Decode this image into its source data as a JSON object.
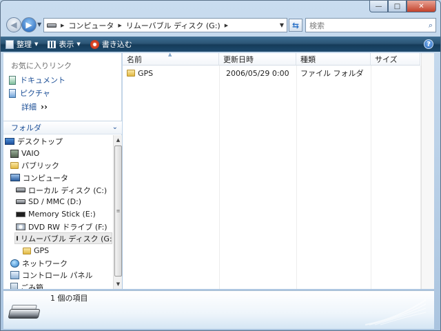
{
  "window": {
    "controls": {
      "minimize": "—",
      "maximize": "□",
      "close": "✕"
    }
  },
  "address_bar": {
    "crumbs": [
      "コンピュータ",
      "リムーバブル ディスク (G:)"
    ],
    "search_placeholder": "検索"
  },
  "toolbar": {
    "organize": "整理",
    "views": "表示",
    "burn": "書き込む",
    "help": "?"
  },
  "favorites": {
    "title": "お気に入りリンク",
    "items": [
      "ドキュメント",
      "ピクチャ"
    ],
    "more": "詳細"
  },
  "folders": {
    "header": "フォルダ",
    "tree": [
      {
        "label": "デスクトップ",
        "icon": "desktop-icon"
      },
      {
        "label": "VAIO",
        "icon": "user-folder-icon"
      },
      {
        "label": "パブリック",
        "icon": "folder-icon"
      },
      {
        "label": "コンピュータ",
        "icon": "computer-icon"
      },
      {
        "label": "ローカル ディスク (C:)",
        "icon": "hard-disk-icon"
      },
      {
        "label": "SD / MMC (D:)",
        "icon": "removable-drive-icon"
      },
      {
        "label": "Memory Stick (E:)",
        "icon": "memory-stick-icon"
      },
      {
        "label": "DVD RW ドライブ (F:)",
        "icon": "dvd-drive-icon"
      },
      {
        "label": "リムーバブル ディスク (G:)",
        "icon": "removable-drive-icon",
        "selected": true
      },
      {
        "label": "GPS",
        "icon": "folder-icon"
      },
      {
        "label": "ネットワーク",
        "icon": "network-icon"
      },
      {
        "label": "コントロール パネル",
        "icon": "control-panel-icon"
      },
      {
        "label": "ごみ箱",
        "icon": "recycle-bin-icon"
      }
    ]
  },
  "file_list": {
    "columns": [
      "名前",
      "更新日時",
      "種類",
      "サイズ"
    ],
    "rows": [
      {
        "name": "GPS",
        "modified": "2006/05/29 0:00",
        "type": "ファイル フォルダ",
        "size": ""
      }
    ]
  },
  "details": {
    "item_count": "1 個の項目"
  },
  "colors": {
    "toolbar": "#1e4a6d",
    "link": "#1b4e96",
    "frame": "#bcd3e8"
  }
}
